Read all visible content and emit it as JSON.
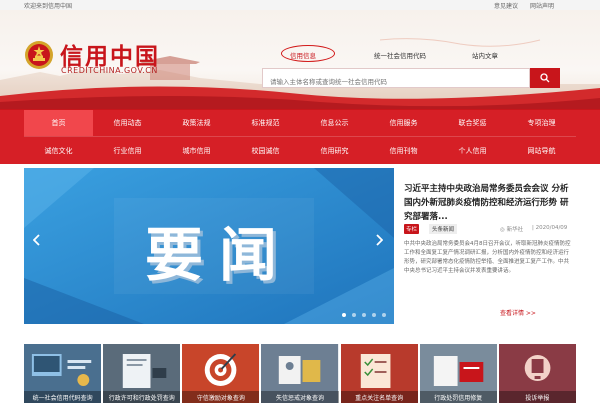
{
  "topbar": {
    "welcome": "欢迎来到信用中国",
    "links": [
      "意见建议",
      "网站声明"
    ]
  },
  "logo": {
    "name": "信用中国",
    "domain": "CREDITCHINA.GOV.CN"
  },
  "search": {
    "tabs": [
      "信用信息",
      "统一社会信用代码",
      "站内文章"
    ],
    "active_tab": "信用信息",
    "placeholder": "请输入主体名称或查询统一社会信用代码"
  },
  "nav": {
    "row1": [
      "首页",
      "信用动态",
      "政策法规",
      "标准规范",
      "信息公示",
      "信用服务",
      "联合奖惩",
      "专项治理"
    ],
    "row2": [
      "诚信文化",
      "行业信用",
      "城市信用",
      "校园诚信",
      "信用研究",
      "信用刊物",
      "个人信用",
      "网站导航"
    ],
    "active": "首页"
  },
  "banner": {
    "text": "要闻",
    "slide_count": 5,
    "active_slide": 1
  },
  "news": {
    "title": "习近平主持中央政治局常务委员会会议 分析国内外新冠肺炎疫情防控和经济运行形势 研究部署落...",
    "badge": "专栏",
    "source": "头条新闻",
    "author": "新华社",
    "date": "2020/04/09",
    "body": "中共中央政治局常务委员会4月8日召开会议，听取新冠肺炎疫情防控工作和全面复工复产情况调研汇报，分析国内外疫情防控和经济运行形势，研究部署常态化疫情防控举措、全面推进复工复产工作。中共中央总书记习近平主持会议并发表重要讲话。",
    "more": "查看详情 >>"
  },
  "services": [
    {
      "label": "统一社会信用代码查询",
      "color": "#4a6f8f"
    },
    {
      "label": "行政许可和行政处罚查询",
      "color": "#5a6b7a"
    },
    {
      "label": "守信激励对象查询",
      "color": "#c8452a"
    },
    {
      "label": "失信惩戒对象查询",
      "color": "#6d7f93"
    },
    {
      "label": "重点关注名单查询",
      "color": "#b83a2c"
    },
    {
      "label": "行政处罚信用修复",
      "color": "#7a8c9c"
    },
    {
      "label": "投诉举报",
      "color": "#8a3b45"
    }
  ]
}
